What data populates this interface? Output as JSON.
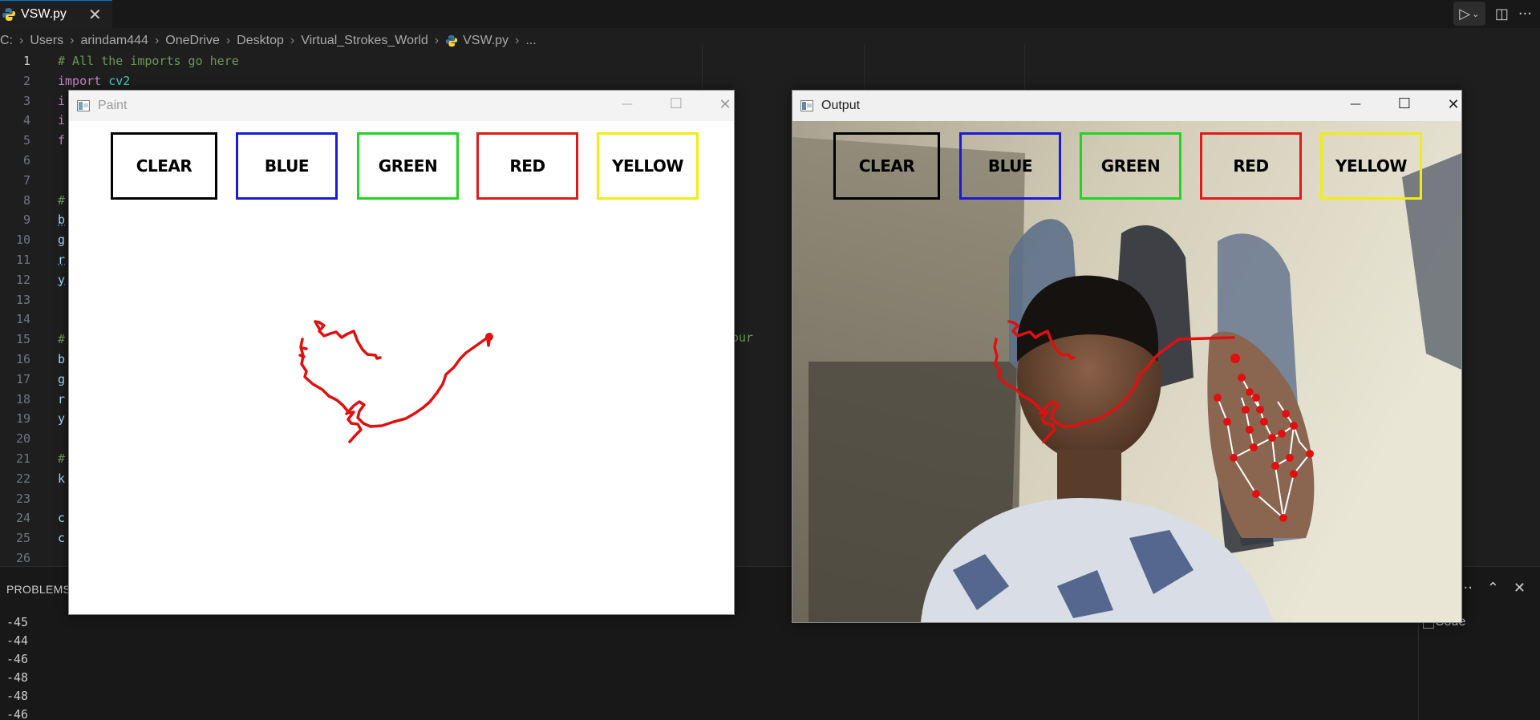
{
  "tab": {
    "label": "VSW.py",
    "close": "✕"
  },
  "breadcrumb": [
    "C:",
    "Users",
    "arindam444",
    "OneDrive",
    "Desktop",
    "Virtual_Strokes_World",
    "VSW.py",
    "..."
  ],
  "editor": {
    "lines": [
      {
        "n": "1",
        "code": "# All the imports go here"
      },
      {
        "n": "2",
        "code": "import cv2"
      },
      {
        "n": "3",
        "code": "i"
      },
      {
        "n": "4",
        "code": "i"
      },
      {
        "n": "5",
        "code": "f"
      },
      {
        "n": "6",
        "code": ""
      },
      {
        "n": "7",
        "code": ""
      },
      {
        "n": "8",
        "code": "#"
      },
      {
        "n": "9",
        "code": "b"
      },
      {
        "n": "10",
        "code": "g"
      },
      {
        "n": "11",
        "code": "r"
      },
      {
        "n": "12",
        "code": "y"
      },
      {
        "n": "13",
        "code": ""
      },
      {
        "n": "14",
        "code": ""
      },
      {
        "n": "15",
        "code": "#"
      },
      {
        "n": "16",
        "code": "b"
      },
      {
        "n": "17",
        "code": "g"
      },
      {
        "n": "18",
        "code": "r"
      },
      {
        "n": "19",
        "code": "y"
      },
      {
        "n": "20",
        "code": ""
      },
      {
        "n": "21",
        "code": "#"
      },
      {
        "n": "22",
        "code": "k"
      },
      {
        "n": "23",
        "code": ""
      },
      {
        "n": "24",
        "code": "c"
      },
      {
        "n": "25",
        "code": "c"
      },
      {
        "n": "26",
        "code": ""
      }
    ],
    "overflow_comment": "our"
  },
  "panel": {
    "tab_label": "PROBLEMS",
    "terminal_lines": [
      "-45",
      "-44",
      "-46",
      "-48",
      "-48",
      "-46"
    ],
    "side_label": "Code"
  },
  "colors": {
    "comment": "#6a9955",
    "keyword": "#c586c0",
    "module": "#4ec9b0",
    "variable": "#9cdcfe",
    "stroke": "#e01010"
  },
  "paint_window": {
    "title": "Paint",
    "buttons": [
      {
        "label": "CLEAR",
        "color": "#000000"
      },
      {
        "label": "BLUE",
        "color": "#1a1ad8"
      },
      {
        "label": "GREEN",
        "color": "#22d422"
      },
      {
        "label": "RED",
        "color": "#e01a1a"
      },
      {
        "label": "YELLOW",
        "color": "#f0ee10"
      }
    ]
  },
  "output_window": {
    "title": "Output",
    "buttons": [
      {
        "label": "CLEAR",
        "color": "#000000"
      },
      {
        "label": "BLUE",
        "color": "#1a1ad8"
      },
      {
        "label": "GREEN",
        "color": "#22d422"
      },
      {
        "label": "RED",
        "color": "#e01a1a"
      },
      {
        "label": "YELLOW",
        "color": "#f0ee10"
      }
    ]
  },
  "icons": {
    "close": "✕",
    "minimize": "—",
    "maximize": "☐",
    "more": "···",
    "chevron_up": "⌃",
    "run": "▷"
  }
}
